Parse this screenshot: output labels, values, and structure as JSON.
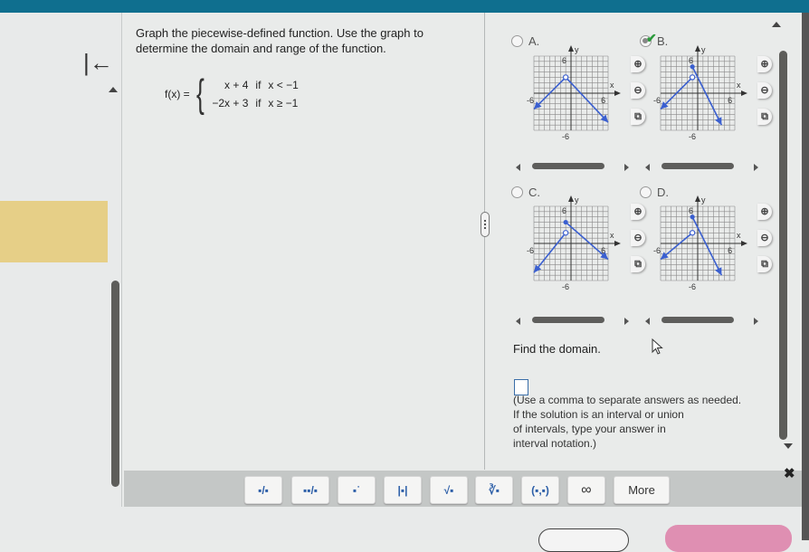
{
  "question": {
    "line1": "Graph the piecewise-defined function. Use the graph to",
    "line2": "determine the domain and range of the function."
  },
  "function": {
    "name": "f(x) =",
    "pieces": [
      {
        "expr": "x + 4",
        "if": "if",
        "cond": "x < −1"
      },
      {
        "expr": "−2x + 3",
        "if": "if",
        "cond": "x ≥ −1"
      }
    ]
  },
  "options": [
    {
      "letter": "A.",
      "selected": false,
      "correct": false,
      "segments": [
        {
          "from": [
            -7,
            -3
          ],
          "to": [
            -1,
            3
          ],
          "start": "arrow",
          "end": "closed"
        },
        {
          "from": [
            -1,
            3
          ],
          "to": [
            7,
            -5.5
          ],
          "start": "open",
          "end": "arrow"
        }
      ]
    },
    {
      "letter": "B.",
      "selected": true,
      "correct": true,
      "segments": [
        {
          "from": [
            -7,
            -3
          ],
          "to": [
            -1,
            3
          ],
          "start": "arrow",
          "end": "open"
        },
        {
          "from": [
            -1,
            5
          ],
          "to": [
            4.5,
            -6
          ],
          "start": "closed",
          "end": "arrow"
        }
      ]
    },
    {
      "letter": "C.",
      "selected": false,
      "correct": false,
      "segments": [
        {
          "from": [
            -7,
            -5.5
          ],
          "to": [
            -1,
            2
          ],
          "start": "arrow",
          "end": "open"
        },
        {
          "from": [
            -1,
            4
          ],
          "to": [
            7,
            -3
          ],
          "start": "closed",
          "end": "arrow"
        }
      ]
    },
    {
      "letter": "D.",
      "selected": false,
      "correct": false,
      "segments": [
        {
          "from": [
            -7,
            -3
          ],
          "to": [
            -1,
            2
          ],
          "start": "arrow",
          "end": "open"
        },
        {
          "from": [
            -1,
            5
          ],
          "to": [
            4.5,
            -6
          ],
          "start": "closed",
          "end": "arrow"
        }
      ]
    }
  ],
  "graph_axes": {
    "x_label": "x",
    "y_label": "y",
    "tick_pos": "6",
    "tick_neg": "-6",
    "range": [
      -7,
      7
    ]
  },
  "graph_colors": {
    "line": "#3a5fd0",
    "grid": "#8a8a8a"
  },
  "graph_controls": [
    "zoom-in",
    "zoom-out",
    "expand"
  ],
  "find": {
    "prompt": "Find the domain."
  },
  "answer": {
    "value": ""
  },
  "hint": {
    "line1": "(Use a comma to separate answers as needed.",
    "line2": "If the solution is an interval or union",
    "line3": "of intervals, type your answer in",
    "line4": "interval notation.)"
  },
  "toolbar": {
    "fraction": "▪/▪",
    "mixed": "▪▪/▪",
    "exponent": "▪˙",
    "abs": "|▪|",
    "sqrt": "√▪",
    "nthroot": "∛▪",
    "interval": "(▪,▪)",
    "infinity": "∞",
    "more": "More"
  },
  "close_label": "✖"
}
